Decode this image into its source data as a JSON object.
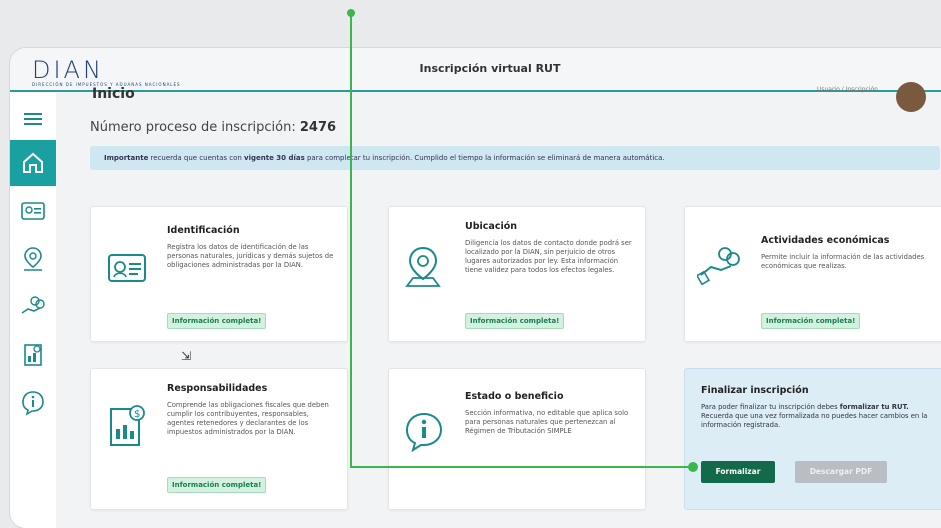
{
  "header": {
    "logo_text": "DIAN",
    "logo_subtext": "DIRECCIÓN DE IMPUESTOS Y ADUANAS NACIONALES",
    "title": "Inscripción virtual RUT",
    "user_text": "Usuario / Inscripción"
  },
  "page": {
    "title": "Inicio",
    "process_label": "Número proceso de inscripción:",
    "process_number": "2476"
  },
  "notice": {
    "bold_start": "Importante",
    "text_1": " recuerda que cuentas con ",
    "bold_mid": "vigente 30 días",
    "text_2": " para completar tu inscripción. Cumplido el tiempo la información se eliminará de manera automática."
  },
  "sidebar": {
    "items": [
      {
        "name": "menu-icon"
      },
      {
        "name": "home-icon"
      },
      {
        "name": "id-card-icon"
      },
      {
        "name": "location-icon"
      },
      {
        "name": "economic-icon"
      },
      {
        "name": "document-icon"
      },
      {
        "name": "info-icon"
      }
    ]
  },
  "cards": [
    {
      "title": "Identificación",
      "desc": "Registra los datos de identificación de las personas naturales, jurídicas y demás sujetos de obligaciones administradas por la DIAN.",
      "badge": "Información completa!"
    },
    {
      "title": "Ubicación",
      "desc": "Diligencia los datos de contacto donde podrá ser localizado por la DIAN, sin perjuicio de otros lugares autorizados por ley. Esta información tiene validez para todos los efectos legales.",
      "badge": "Información completa!"
    },
    {
      "title": "Actividades económicas",
      "desc": "Permite incluir la información de las actividades económicas que realizas.",
      "badge": "Información completa!"
    },
    {
      "title": "Responsabilidades",
      "desc": "Comprende las obligaciones fiscales que deben cumplir los contribuyentes, responsables, agentes retenedores y declarantes de los impuestos administrados por la DIAN.",
      "badge": "Información completa!"
    },
    {
      "title": "Estado o beneficio",
      "desc": "Sección informativa, no editable que aplica solo para personas naturales que pertenezcan al Régimen de Tributación SIMPLE"
    }
  ],
  "finalize": {
    "title": "Finalizar inscripción",
    "desc_1": "Para poder finalizar tu inscripción debes ",
    "desc_bold": "formalizar tu RUT.",
    "desc_2": " Recuerda que una vez formalizada no puedes hacer cambios en la información registrada.",
    "primary_label": "Formalizar",
    "secondary_label": "Descargar PDF"
  },
  "colors": {
    "teal": "#1aa0a0",
    "green_button": "#136a4a",
    "badge_bg": "#d3f1df",
    "guide_line": "#3cb64a"
  }
}
